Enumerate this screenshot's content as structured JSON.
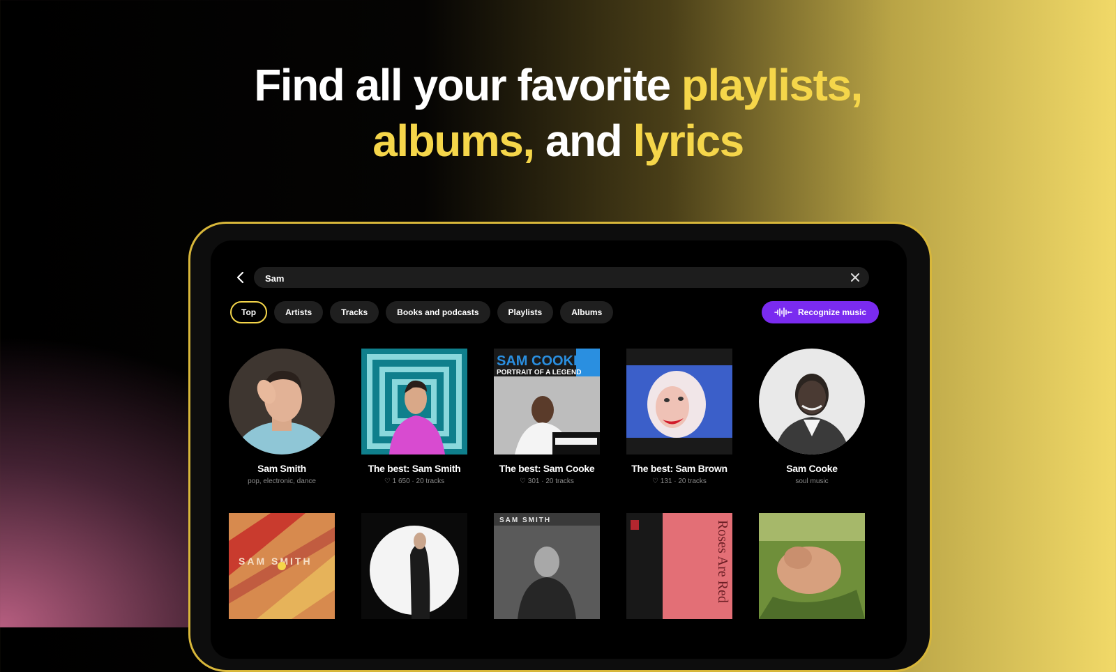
{
  "headline": {
    "line1_white": "Find all your favorite ",
    "line1_yellow": "playlists,",
    "line2_yellow_1": "albums,",
    "line2_white": " and ",
    "line2_yellow_2": "lyrics"
  },
  "search": {
    "value": "Sam",
    "back_icon": "chevron-left-icon",
    "clear_icon": "close-icon"
  },
  "filters": [
    "Top",
    "Artists",
    "Tracks",
    "Books and podcasts",
    "Playlists",
    "Albums"
  ],
  "recognize_label": "Recognize music",
  "results_row1": [
    {
      "title": "Sam Smith",
      "subtitle": "pop, electronic, dance",
      "shape": "round"
    },
    {
      "title": "The best: Sam Smith",
      "subtitle": "♡ 1 650 · 20 tracks",
      "shape": "square"
    },
    {
      "title": "The best: Sam Cooke",
      "subtitle": "♡ 301 · 20 tracks",
      "shape": "square",
      "cover_text_1": "SAM COOKE",
      "cover_text_2": "PORTRAIT OF A LEGEND"
    },
    {
      "title": "The best: Sam Brown",
      "subtitle": "♡ 131 · 20 tracks",
      "shape": "square"
    },
    {
      "title": "Sam Cooke",
      "subtitle": "soul music",
      "shape": "round"
    }
  ],
  "results_row2_covers": [
    {
      "cover_text": "SAM SMITH"
    },
    {
      "cover_text": ""
    },
    {
      "cover_text": "SAM SMITH"
    },
    {
      "cover_text": "Roses Are Red"
    },
    {
      "cover_text": ""
    }
  ],
  "colors": {
    "accent": "#f5d64a",
    "recognize": "#7a2bf0",
    "chip": "#1f1f1f"
  }
}
